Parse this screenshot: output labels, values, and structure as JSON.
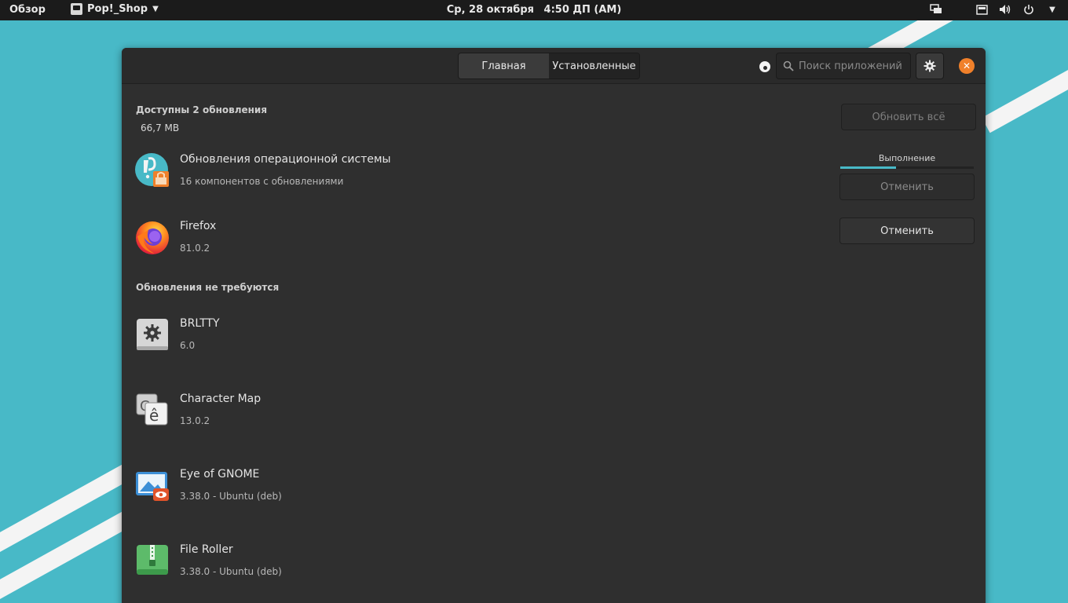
{
  "topbar": {
    "overview": "Обзор",
    "app_name": "Pop!_Shop",
    "date": "Ср, 28 октября",
    "time": "4:50 ДП (АМ)"
  },
  "header": {
    "tabs": [
      {
        "label": "Главная"
      },
      {
        "label": "Установленные"
      }
    ],
    "search_placeholder": "Поиск приложений"
  },
  "updates": {
    "title": "Доступны 2 обновления",
    "size": "66,7 MB",
    "update_all_label": "Обновить всё",
    "progress_label": "Выполнение",
    "progress_fraction": 0.42,
    "items": [
      {
        "name": "Обновления операционной системы",
        "sub": "16 компонентов с обновлениями",
        "icon": "pop-os-updates-icon",
        "action": "Отменить"
      },
      {
        "name": "Firefox",
        "sub": "81.0.2",
        "icon": "firefox-icon",
        "action": "Отменить"
      }
    ]
  },
  "no_updates": {
    "title": "Обновления не требуются",
    "items": [
      {
        "name": "BRLTTY",
        "sub": "6.0",
        "icon": "brltty-gear-icon"
      },
      {
        "name": "Character Map",
        "sub": "13.0.2",
        "icon": "character-map-icon"
      },
      {
        "name": "Eye of GNOME",
        "sub": "3.38.0 - Ubuntu (deb)",
        "icon": "eye-of-gnome-icon"
      },
      {
        "name": "File Roller",
        "sub": "3.38.0 - Ubuntu (deb)",
        "icon": "file-roller-icon"
      }
    ]
  },
  "colors": {
    "accent": "#48b9c7",
    "close": "#f0802a",
    "window_bg": "#2f2f2f"
  }
}
